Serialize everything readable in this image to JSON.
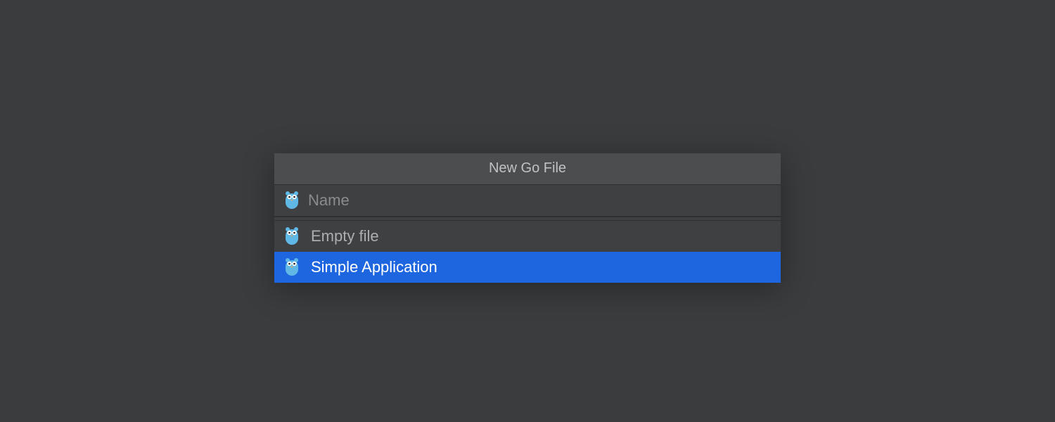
{
  "dialog": {
    "title": "New Go File",
    "input": {
      "placeholder": "Name",
      "value": ""
    },
    "options": [
      {
        "label": "Empty file",
        "selected": false
      },
      {
        "label": "Simple Application",
        "selected": true
      }
    ]
  }
}
